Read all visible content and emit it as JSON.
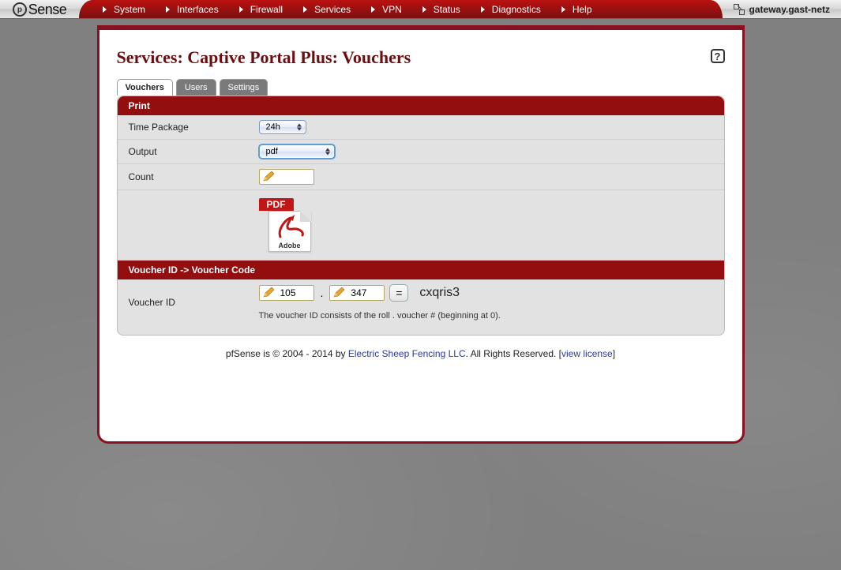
{
  "brand": "Sense",
  "nav": {
    "items": [
      "System",
      "Interfaces",
      "Firewall",
      "Services",
      "VPN",
      "Status",
      "Diagnostics",
      "Help"
    ]
  },
  "host": "gateway.gast-netz",
  "page": {
    "title": "Services: Captive Portal Plus: Vouchers"
  },
  "tabs": [
    "Vouchers",
    "Users",
    "Settings"
  ],
  "tabs_active_index": 0,
  "sections": {
    "print": {
      "header": "Print",
      "time_label": "Time Package",
      "time_value": "24h",
      "output_label": "Output",
      "output_value": "pdf",
      "count_label": "Count",
      "count_value": "",
      "pdf_label": "PDF",
      "pdf_adobe": "Adobe"
    },
    "lookup": {
      "header": "Voucher ID -> Voucher Code",
      "id_label": "Voucher ID",
      "roll_value": "105",
      "num_value": "347",
      "eq_label": "=",
      "code": "cxqris3",
      "hint": "The voucher ID consists of the roll . voucher # (beginning at 0)."
    }
  },
  "footer": {
    "pre": "pfSense is © 2004 - 2014 by ",
    "link1": "Electric Sheep Fencing LLC",
    "mid": ". All Rights Reserved. [",
    "link2": "view license",
    "post": "]"
  }
}
